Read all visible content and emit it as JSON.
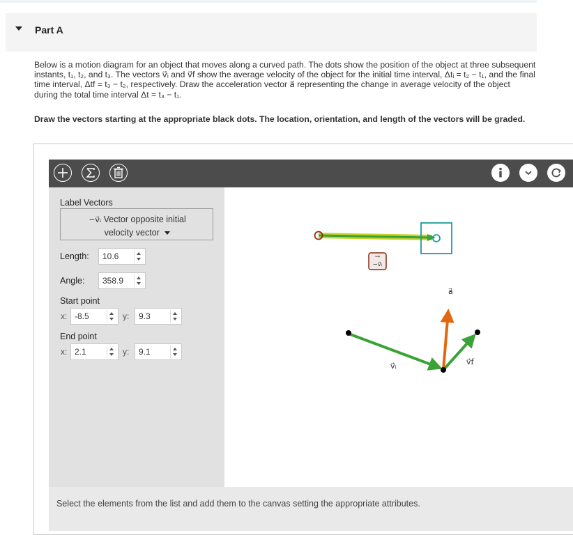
{
  "part": {
    "title": "Part A"
  },
  "prompt": {
    "text": "Below is a motion diagram for an object that moves along a curved path. The dots show the position of the object at three subsequent instants, t₁, t₂, and t₃. The vectors v⃗ᵢ and v⃗f show the average velocity of the object for the initial time interval, Δtᵢ = t₂ − t₁, and the final time interval, Δtf = t₃ − t₂, respectively. Draw the acceleration vector a⃗ representing the change in average velocity of the object during the total time interval Δt = t₃ − t₁.",
    "instruction": "Draw the vectors starting at the appropriate black dots. The location, orientation, and length of the vectors will be graded."
  },
  "toolbar": {
    "add_icon": "plus-icon",
    "sum_icon": "sigma-icon",
    "delete_icon": "trash-icon",
    "info_icon": "info-icon",
    "expand_icon": "chevron-down-icon",
    "reset_icon": "reset-icon"
  },
  "panel": {
    "label_vectors": "Label Vectors",
    "selected_vector": {
      "symbol": "−v⃗ᵢ",
      "line1": "Vector opposite initial",
      "line2": "velocity vector"
    },
    "length_label": "Length:",
    "length_value": "10.6",
    "angle_label": "Angle:",
    "angle_value": "358.9",
    "start_label": "Start point",
    "start_x": "-8.5",
    "start_y": "9.3",
    "end_label": "End point",
    "end_x": "2.1",
    "end_y": "9.1",
    "x_label": "x:",
    "y_label": "y:"
  },
  "canvas": {
    "labels": {
      "vi": "v⃗ᵢ",
      "vf": "v⃗f",
      "a": "a⃗",
      "neg_vi_badge": "−v⃗ᵢ"
    },
    "colors": {
      "velocity": "#3aa335",
      "acceleration": "#e2680f",
      "selected": "#c7d22a",
      "handle": "#1f9a9a",
      "start_handle": "#8b2a12"
    }
  },
  "status": {
    "message": "Select the elements from the list and add them to the canvas setting the appropriate attributes."
  }
}
